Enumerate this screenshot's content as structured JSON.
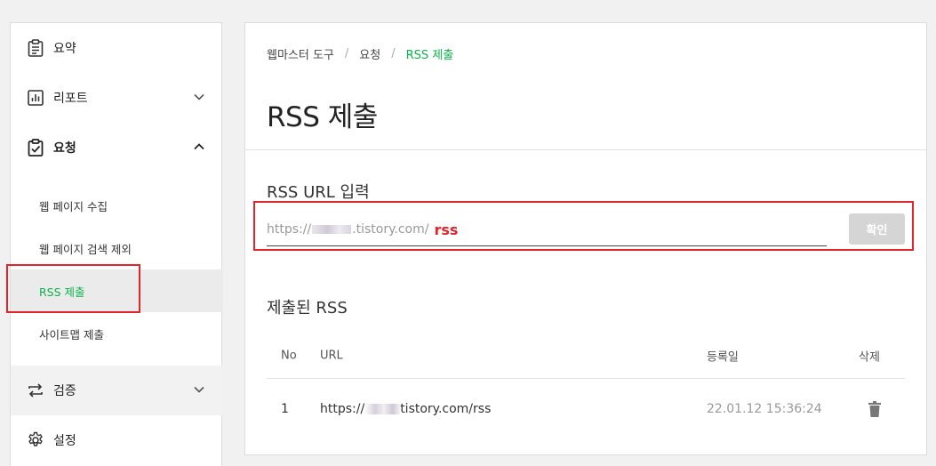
{
  "sidebar": {
    "summary": "요약",
    "report": "리포트",
    "request": "요청",
    "sub": [
      "웹 페이지 수집",
      "웹 페이지 검색 제외",
      "RSS 제출",
      "사이트맵 제출"
    ],
    "verify": "검증",
    "settings": "설정"
  },
  "breadcrumb": [
    "웹마스터 도구",
    "요청",
    "RSS 제출"
  ],
  "page_title": "RSS 제출",
  "rss_input": {
    "section_title": "RSS URL 입력",
    "prefix_start": "https://",
    "prefix_end": ".tistory.com/",
    "value": "rss",
    "confirm_label": "확인"
  },
  "submitted": {
    "section_title": "제출된 RSS",
    "columns": [
      "No",
      "URL",
      "등록일",
      "삭제"
    ],
    "rows": [
      {
        "no": "1",
        "url_start": "https://",
        "url_end": "tistory.com/rss",
        "date": "22.01.12 15:36:24"
      }
    ]
  },
  "colors": {
    "accent_green": "#0bb24a",
    "highlight_red": "#e1252b"
  }
}
